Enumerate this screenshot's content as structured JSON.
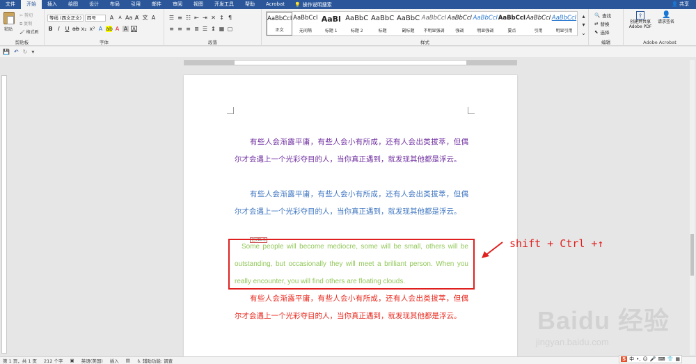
{
  "menu": {
    "tabs": [
      "文件",
      "开始",
      "插入",
      "绘图",
      "设计",
      "布局",
      "引用",
      "邮件",
      "审阅",
      "视图",
      "开发工具",
      "帮助",
      "Acrobat"
    ],
    "active_tab": "开始",
    "tell_me": "操作说明搜索",
    "share": "共享"
  },
  "ribbon": {
    "clipboard": {
      "paste": "粘贴",
      "cut": "剪切",
      "copy": "复制",
      "format_painter": "格式刷",
      "label": "剪贴板"
    },
    "font": {
      "font_name": "等线 (西文正文)",
      "font_size": "四号",
      "label": "字体"
    },
    "paragraph": {
      "label": "段落"
    },
    "styles": {
      "label": "样式",
      "items": [
        {
          "sample": "AaBbCcI",
          "name": "正文"
        },
        {
          "sample": "AaBbCcI",
          "name": "无间隔"
        },
        {
          "sample": "AaBl",
          "name": "标题 1"
        },
        {
          "sample": "AaBbC",
          "name": "标题 2"
        },
        {
          "sample": "AaBbC",
          "name": "标题"
        },
        {
          "sample": "AaBbC",
          "name": "副标题"
        },
        {
          "sample": "AaBbCcI",
          "name": "不明显强调"
        },
        {
          "sample": "AaBbCcI",
          "name": "强调"
        },
        {
          "sample": "AaBbCcI",
          "name": "明显强调"
        },
        {
          "sample": "AaBbCcI",
          "name": "要点"
        },
        {
          "sample": "AaBbCcI",
          "name": "引用"
        },
        {
          "sample": "AaBbCcI",
          "name": "明显引用"
        }
      ]
    },
    "editing": {
      "find": "查找",
      "replace": "替换",
      "select": "选择",
      "label": "编辑"
    },
    "acrobat": {
      "create_share": "创建并共享 Adobe PDF",
      "request_sign": "请求签名",
      "label": "Adobe Acrobat"
    }
  },
  "document": {
    "para_purple": "有些人会渐露平庸，有些人会小有所成，还有人会出类拔萃，但偶尔才会遇上一个光彩夺目的人，当你真正遇到，就发现其他都是浮云。",
    "para_blue": "有些人会渐露平庸，有些人会小有所成，还有人会出类拔萃，但偶尔才会遇上一个光彩夺目的人，当你真正遇到，就发现其他都是浮云。",
    "para_green": "Some people will become mediocre, some will be small, others will be outstanding, but occasionally they will meet a brilliant person. When you really encounter, you will find others are floating clouds.",
    "para_red": "有些人会渐露平庸，有些人会小有所成，还有人会出类拔萃，但偶尔才会遇上一个光彩夺目的人，当你真正遇到，就发现其他都是浮云。",
    "paste_tag": "(Ctrl)"
  },
  "annotation": {
    "text": "shift + Ctrl +↑"
  },
  "status": {
    "page": "第 1 页，共 1 页",
    "words": "212 个字",
    "language": "英语(美国)",
    "mode": "插入",
    "accessibility": "辅助功能: 调查"
  },
  "ime": {
    "logo": "S",
    "lang": "中"
  },
  "watermark": {
    "brand": "Baidu 经验",
    "url": "jingyan.baidu.com"
  },
  "colors": {
    "purple": "#7030a0",
    "blue": "#3f76c1",
    "green": "#92c85a",
    "red": "#e8281e",
    "accent": "#2b579a"
  }
}
